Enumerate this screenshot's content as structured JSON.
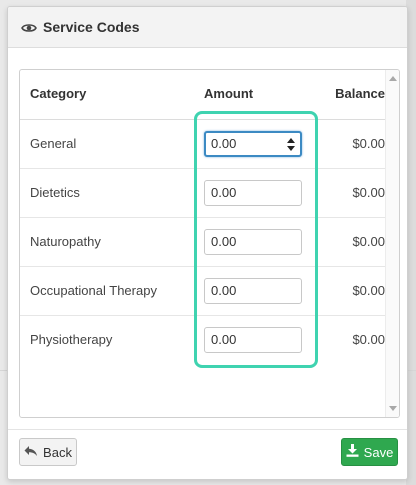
{
  "dialog": {
    "title": "Service Codes",
    "title_icon": "eye-icon"
  },
  "table": {
    "headers": {
      "category": "Category",
      "amount": "Amount",
      "balance": "Balance"
    },
    "rows": [
      {
        "category": "General",
        "amount": "0.00",
        "balance": "$0.00"
      },
      {
        "category": "Dietetics",
        "amount": "0.00",
        "balance": "$0.00"
      },
      {
        "category": "Naturopathy",
        "amount": "0.00",
        "balance": "$0.00"
      },
      {
        "category": "Occupational Therapy",
        "amount": "0.00",
        "balance": "$0.00"
      },
      {
        "category": "Physiotherapy",
        "amount": "0.00",
        "balance": "$0.00"
      }
    ]
  },
  "footer": {
    "back_label": "Back",
    "back_icon": "reply-arrow-icon",
    "save_label": "Save",
    "save_icon": "download-icon"
  },
  "colors": {
    "highlight": "#3fd3b0",
    "save_green": "#2fa84f",
    "focus_blue": "#3c8ac3"
  }
}
